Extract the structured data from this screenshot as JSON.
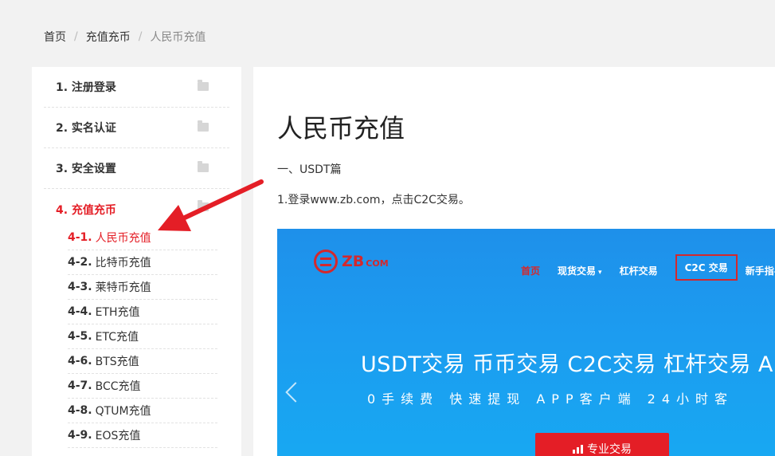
{
  "breadcrumb": {
    "home": "首页",
    "section": "充值充币",
    "current": "人民币充值",
    "separator": "/"
  },
  "sidebar": {
    "sections": [
      {
        "label": "1. 注册登录"
      },
      {
        "label": "2. 实名认证"
      },
      {
        "label": "3. 安全设置"
      },
      {
        "label": "4. 充值充币"
      }
    ],
    "sub_items": [
      {
        "num": "4-1.",
        "label": "人民币充值"
      },
      {
        "num": "4-2.",
        "label": "比特币充值"
      },
      {
        "num": "4-3.",
        "label": "莱特币充值"
      },
      {
        "num": "4-4.",
        "label": "ETH充值"
      },
      {
        "num": "4-5.",
        "label": "ETC充值"
      },
      {
        "num": "4-6.",
        "label": "BTS充值"
      },
      {
        "num": "4-7.",
        "label": "BCC充值"
      },
      {
        "num": "4-8.",
        "label": "QTUM充值"
      },
      {
        "num": "4-9.",
        "label": "EOS充值"
      }
    ]
  },
  "article": {
    "title": "人民币充值",
    "section_heading": "一、USDT篇",
    "step1": "1.登录www.zb.com，点击C2C交易。"
  },
  "screenshot": {
    "logo_text": "ZB",
    "logo_suffix": "COM",
    "nav": {
      "home": "首页",
      "spot": "现货交易",
      "leverage": "杠杆交易",
      "c2c": "C2C 交易",
      "guide": "新手指导"
    },
    "banner_headline": "USDT交易 币币交易 C2C交易 杠杆交易 A",
    "banner_subline": "0手续费 快速提现 APP客户端 24小时客",
    "pro_button": "专业交易"
  },
  "colors": {
    "accent_red": "#e41e26",
    "banner_blue": "#1c9cf0",
    "page_bg": "#f2f2f2"
  },
  "icons": {
    "folder": "folder-icon",
    "prev": "chevron-left-icon",
    "chart": "bar-chart-icon",
    "annotation": "red-arrow-annotation"
  }
}
